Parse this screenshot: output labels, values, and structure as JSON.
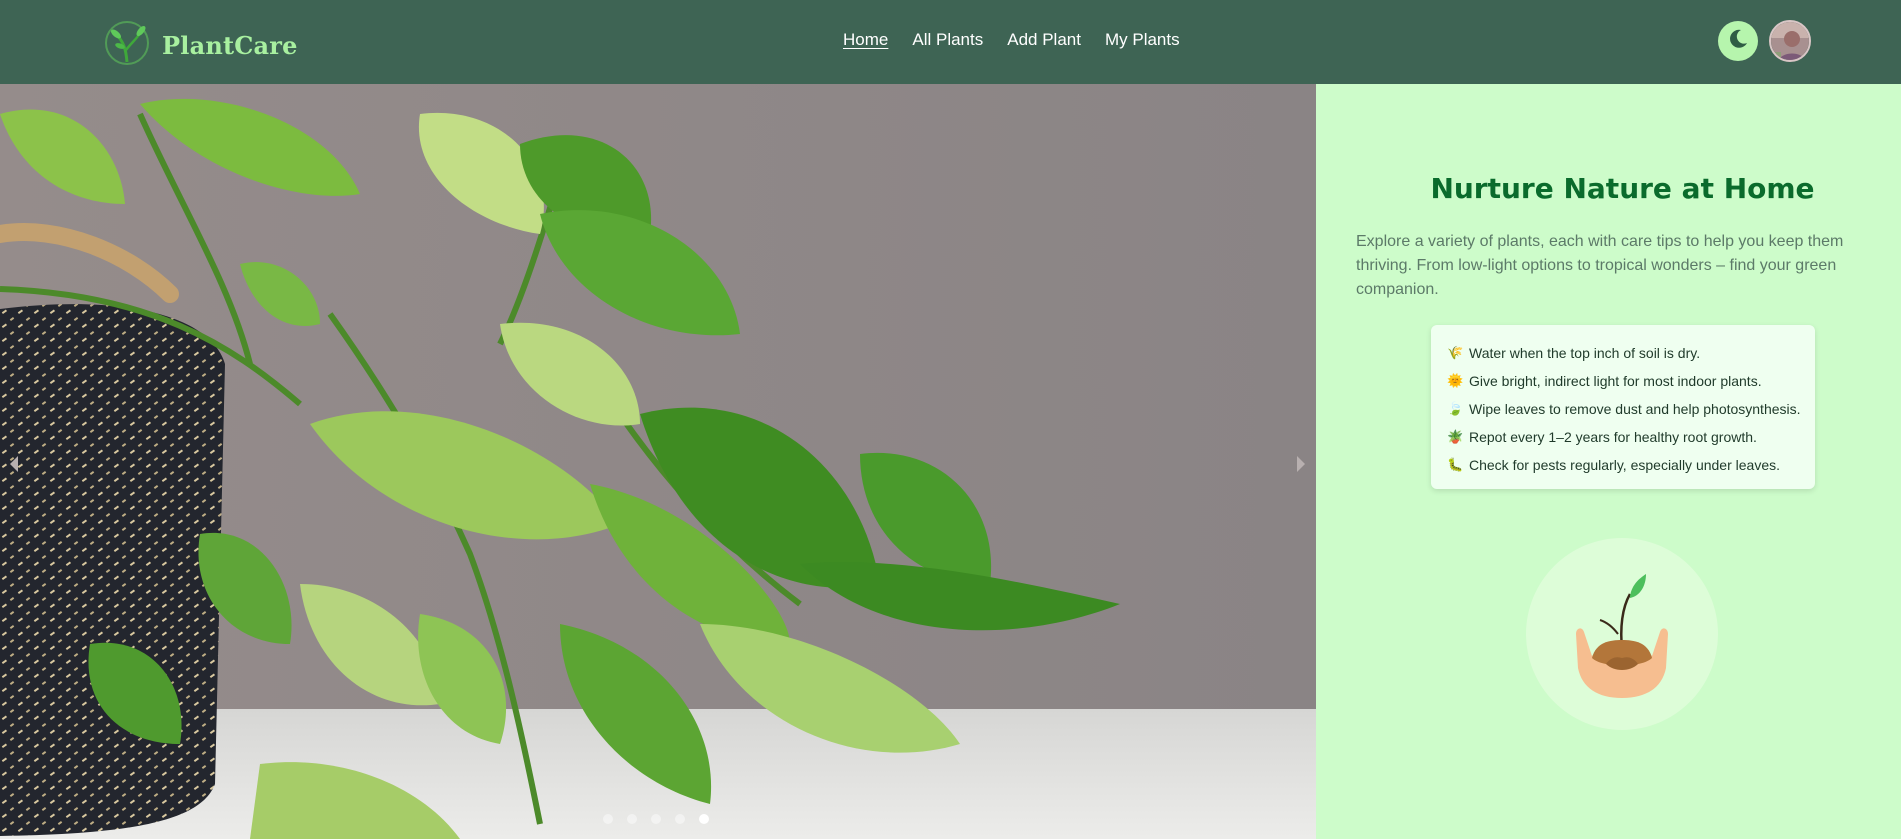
{
  "header": {
    "brand": "PlantCare",
    "nav": [
      {
        "label": "Home",
        "active": true
      },
      {
        "label": "All Plants",
        "active": false
      },
      {
        "label": "Add Plant",
        "active": false
      },
      {
        "label": "My Plants",
        "active": false
      }
    ],
    "icons": {
      "logo": "plant-logo-icon",
      "theme": "moon-icon",
      "avatar": "user-avatar"
    }
  },
  "hero": {
    "slide_count": 5,
    "active_slide": 5,
    "icons": {
      "prev": "chevron-left-icon",
      "next": "chevron-right-icon"
    }
  },
  "info": {
    "title": "Nurture Nature at Home",
    "description": "Explore a variety of plants, each with care tips to help you keep them thriving. From low-light options to tropical wonders – find your green companion.",
    "tips": [
      {
        "icon": "🌾",
        "text": "Water when the top inch of soil is dry."
      },
      {
        "icon": "🌞",
        "text": "Give bright, indirect light for most indoor plants."
      },
      {
        "icon": "🍃",
        "text": "Wipe leaves to remove dust and help photosynthesis."
      },
      {
        "icon": "🪴",
        "text": "Repot every 1–2 years for healthy root growth."
      },
      {
        "icon": "🐛",
        "text": "Check for pests regularly, especially under leaves."
      }
    ]
  },
  "colors": {
    "header_bg": "#3e6454",
    "brand": "#a8f0a0",
    "panel_bg": "#cdfcca",
    "title": "#0a6b2c"
  }
}
